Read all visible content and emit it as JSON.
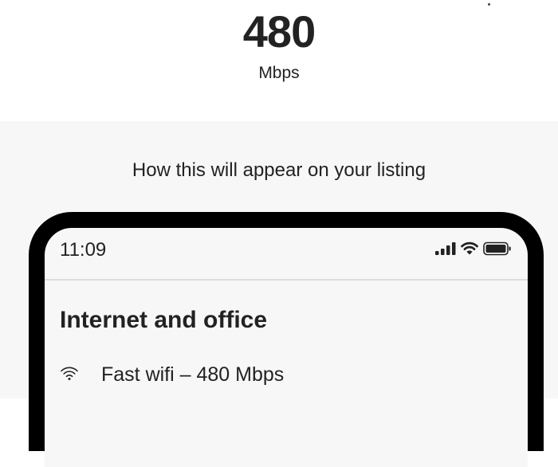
{
  "speed": {
    "value": "480",
    "unit": "Mbps"
  },
  "preview": {
    "caption": "How this will appear on your listing",
    "phone": {
      "time": "11:09",
      "icons": [
        "signal-bars-icon",
        "wifi-icon",
        "battery-icon"
      ],
      "section_title": "Internet and office",
      "amenities": [
        {
          "icon": "wifi-icon",
          "label": "Fast wifi – 480 Mbps"
        }
      ]
    }
  },
  "colors": {
    "text": "#222222",
    "preview_background": "#f7f7f7",
    "phone_frame": "#000000",
    "divider": "#dddddd"
  }
}
